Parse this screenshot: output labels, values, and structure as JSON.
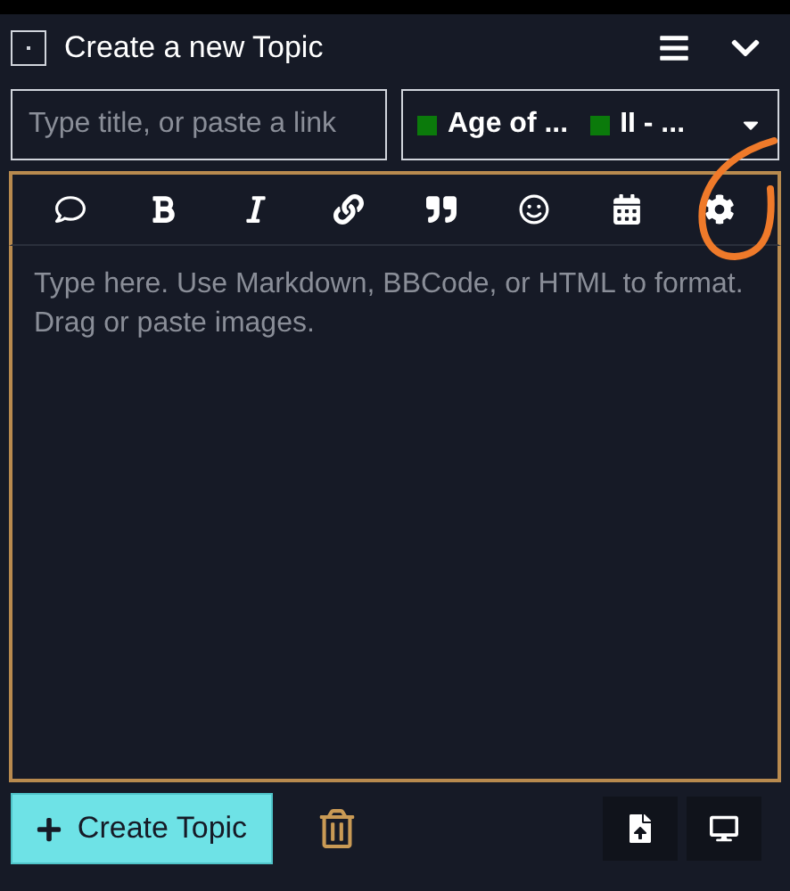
{
  "header": {
    "title": "Create a new Topic"
  },
  "title_field": {
    "placeholder": "Type title, or paste a link"
  },
  "category_select": {
    "chips": [
      {
        "label": "Age of ...",
        "color": "#0b7a0b"
      },
      {
        "label": "II - ...",
        "color": "#0b7a0b"
      }
    ]
  },
  "editor": {
    "placeholder": "Type here. Use Markdown, BBCode, or HTML to format. Drag or paste images."
  },
  "footer": {
    "create_button": "Create Topic"
  }
}
